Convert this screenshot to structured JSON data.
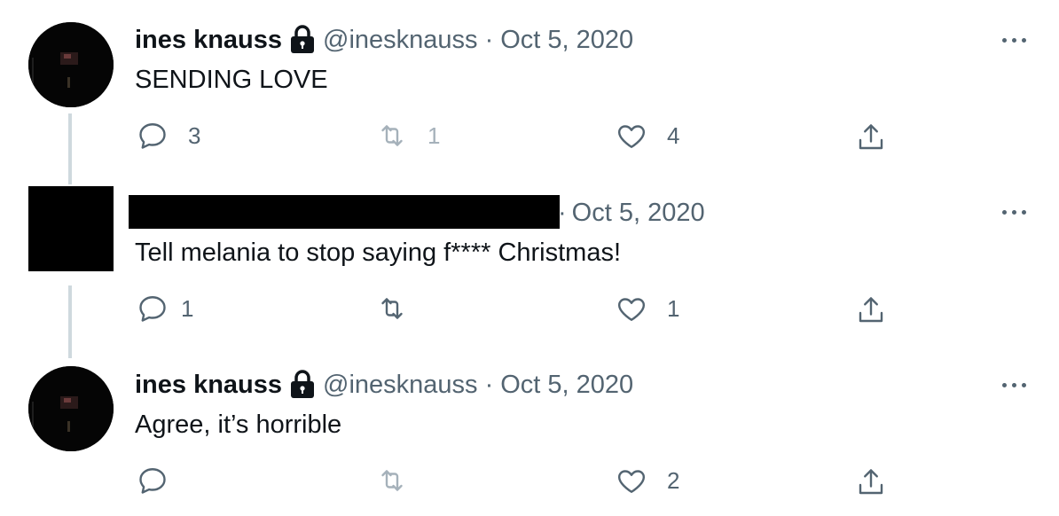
{
  "tweets": [
    {
      "author_name": "ines knauss",
      "handle": "@inesknauss",
      "separator": "·",
      "date": "Oct 5, 2020",
      "text": "SENDING LOVE",
      "reply_count": "3",
      "retweet_count": "1",
      "like_count": "4"
    },
    {
      "author_name": "",
      "handle": "",
      "separator": "·",
      "date": "Oct 5, 2020",
      "text": "Tell melania to stop saying f**** Christmas!",
      "reply_count": "1",
      "retweet_count": "",
      "like_count": "1"
    },
    {
      "author_name": "ines knauss",
      "handle": "@inesknauss",
      "separator": "·",
      "date": "Oct 5, 2020",
      "text": "Agree, it’s horrible",
      "reply_count": "",
      "retweet_count": "",
      "like_count": "2"
    }
  ],
  "icons": {
    "reply": "reply-icon",
    "retweet": "retweet-icon",
    "like": "like-icon",
    "share": "share-icon",
    "more": "more-icon",
    "lock": "lock-icon"
  },
  "colors": {
    "text_primary": "#0f1419",
    "text_secondary": "#536471",
    "thread_line": "#cfd9de"
  }
}
